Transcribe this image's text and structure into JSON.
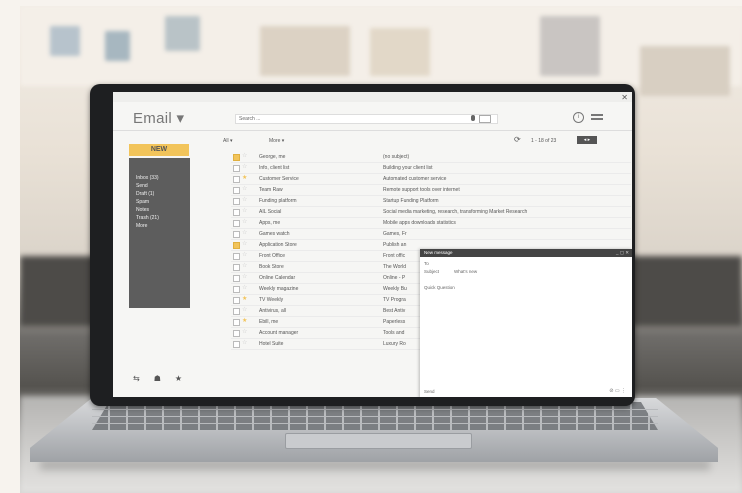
{
  "app": {
    "title": "Email",
    "search_placeholder": "Search ...",
    "new_button": "NEW"
  },
  "sidebar": {
    "items": [
      "Inbox (33)",
      "Send",
      "Draft (1)",
      "Spam",
      "Notes",
      "Trash (21)",
      "More"
    ]
  },
  "toolbar": {
    "all_label": "All",
    "more_label": "More",
    "pager_text": "1 - 18 of 23"
  },
  "emails": [
    {
      "sender": "George, me",
      "subject": "(no subject)",
      "checked": true,
      "starred": false
    },
    {
      "sender": "Info, client list",
      "subject": "Building your client list",
      "checked": false,
      "starred": false
    },
    {
      "sender": "Customer Service",
      "subject": "Automated customer service",
      "checked": false,
      "starred": true
    },
    {
      "sender": "Team Raw",
      "subject": "Remote support tools over internet",
      "checked": false,
      "starred": false
    },
    {
      "sender": "Funding platform",
      "subject": "Startup Funding Platform",
      "checked": false,
      "starred": false
    },
    {
      "sender": "AIL Social",
      "subject": "Social media marketing, research, transforming Market Research",
      "checked": false,
      "starred": false
    },
    {
      "sender": "Apps, me",
      "subject": "Mobile apps downloads statistics",
      "checked": false,
      "starred": false
    },
    {
      "sender": "Games watch",
      "subject": "Games, Fr",
      "checked": false,
      "starred": false
    },
    {
      "sender": "Application Store",
      "subject": "Publish an",
      "checked": true,
      "starred": false
    },
    {
      "sender": "Front Office",
      "subject": "Front offic",
      "checked": false,
      "starred": false
    },
    {
      "sender": "Book Store",
      "subject": "The World",
      "checked": false,
      "starred": false
    },
    {
      "sender": "Online Calendar",
      "subject": "Online - P",
      "checked": false,
      "starred": false
    },
    {
      "sender": "Weekly magazine",
      "subject": "Weekly Bu",
      "checked": false,
      "starred": false
    },
    {
      "sender": "TV Weekly",
      "subject": "TV Progra",
      "checked": false,
      "starred": true
    },
    {
      "sender": "Antivirus, all",
      "subject": "Best Antiv",
      "checked": false,
      "starred": false
    },
    {
      "sender": "Ebill, me",
      "subject": "Paperless",
      "checked": false,
      "starred": true
    },
    {
      "sender": "Account manager",
      "subject": "Tools and",
      "checked": false,
      "starred": false
    },
    {
      "sender": "Hotel Suite",
      "subject": "Luxury Ro",
      "checked": false,
      "starred": false
    }
  ],
  "compose": {
    "header": "New message",
    "to_label": "To",
    "subject_label": "Subject",
    "subject_value": "What's new",
    "body": "Quick Question",
    "send_label": "Send"
  },
  "colors": {
    "accent": "#f2c45a",
    "sidebar_bg": "#5d5d5d",
    "bezel": "#1e1f21"
  }
}
